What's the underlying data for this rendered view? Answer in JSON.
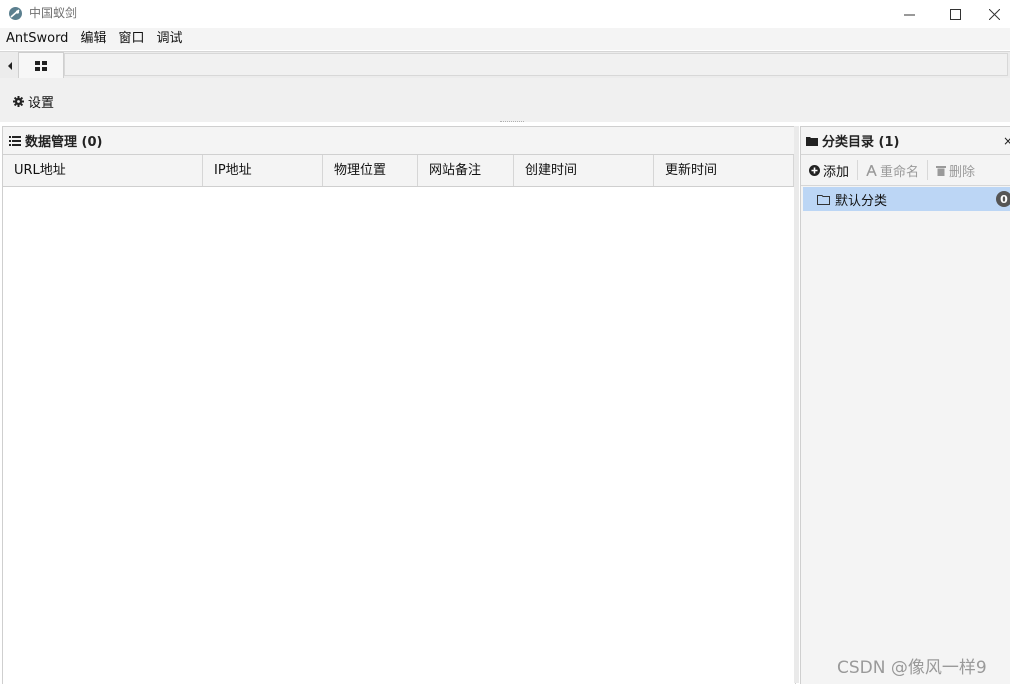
{
  "window": {
    "title": "中国蚁剑",
    "controls": {
      "minimize": "—",
      "maximize": "☐",
      "close": "✕"
    }
  },
  "menu": {
    "items": [
      "AntSword",
      "编辑",
      "窗口",
      "调试"
    ]
  },
  "toolbar": {
    "settings_label": "设置"
  },
  "data_panel": {
    "title": "数据管理 (0)",
    "columns": [
      "URL地址",
      "IP地址",
      "物理位置",
      "网站备注",
      "创建时间",
      "更新时间"
    ],
    "rows": []
  },
  "category_panel": {
    "title": "分类目录 (1)",
    "close": "×",
    "add_label": "添加",
    "rename_label": "重命名",
    "delete_label": "删除",
    "items": [
      {
        "label": "默认分类",
        "count": "0"
      }
    ]
  },
  "watermark": "CSDN @像风一样9",
  "colors": {
    "selection": "#bcd6f5",
    "badge": "#555555",
    "toolbar_bg": "#f0f0f0"
  }
}
